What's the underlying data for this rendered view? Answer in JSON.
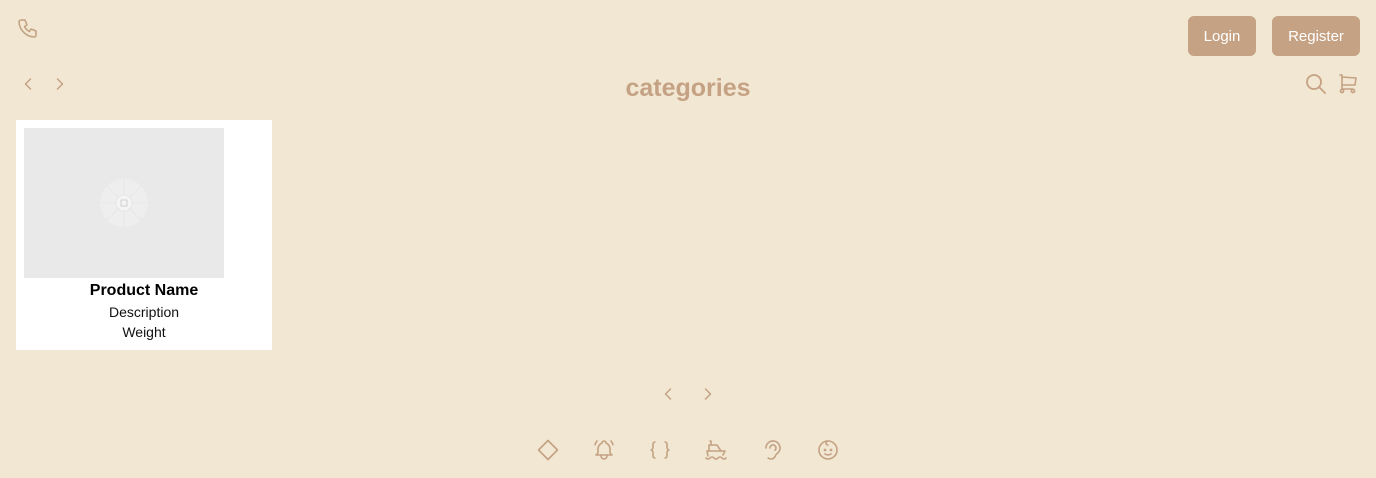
{
  "header": {
    "login_label": "Login",
    "register_label": "Register",
    "phone_icon": "phone-icon",
    "search_icon": "search-icon",
    "cart_icon": "cart-icon"
  },
  "page": {
    "title": "categories"
  },
  "products": [
    {
      "name": "Product Name",
      "description": "Description",
      "weight": "Weight",
      "image": "image-placeholder"
    }
  ],
  "footer": {
    "icons": [
      "diamond-icon",
      "bell-ringing-icon",
      "braces-icon",
      "ship-icon",
      "ear-icon",
      "baby-face-icon"
    ]
  },
  "colors": {
    "background": "#f2e7d3",
    "accent": "#c4a283",
    "card": "#ffffff",
    "placeholder": "#e9e9e9"
  }
}
